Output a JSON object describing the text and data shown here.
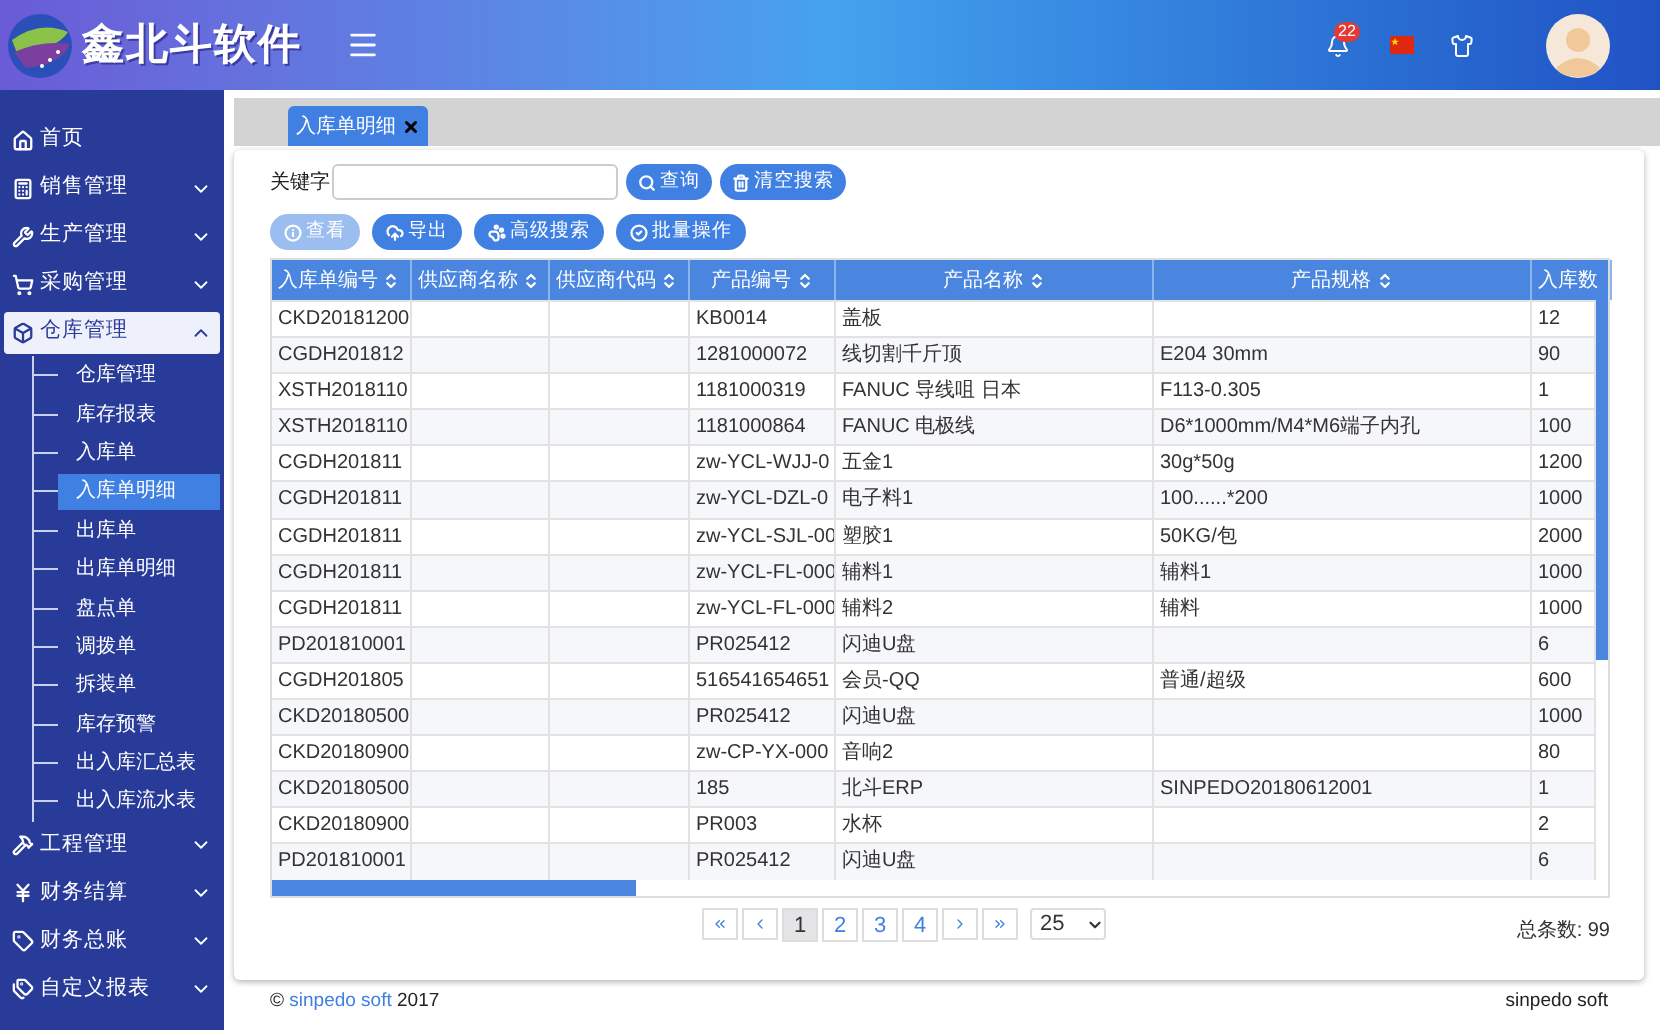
{
  "header": {
    "title": "鑫北斗软件",
    "notifications": "22"
  },
  "sidebar": {
    "items": [
      {
        "kind": "link",
        "label": "首页"
      },
      {
        "kind": "group",
        "label": "销售管理",
        "expanded": false
      },
      {
        "kind": "group",
        "label": "生产管理",
        "expanded": false
      },
      {
        "kind": "group",
        "label": "采购管理",
        "expanded": false
      },
      {
        "kind": "group",
        "label": "仓库管理",
        "expanded": true,
        "children": [
          {
            "label": "仓库管理",
            "selected": false
          },
          {
            "label": "库存报表",
            "selected": false
          },
          {
            "label": "入库单",
            "selected": false
          },
          {
            "label": "入库单明细",
            "selected": true
          },
          {
            "label": "出库单",
            "selected": false
          },
          {
            "label": "出库单明细",
            "selected": false
          },
          {
            "label": "盘点单",
            "selected": false
          },
          {
            "label": "调拨单",
            "selected": false
          },
          {
            "label": "拆装单",
            "selected": false
          },
          {
            "label": "库存预警",
            "selected": false
          },
          {
            "label": "出入库汇总表",
            "selected": false
          },
          {
            "label": "出入库流水表",
            "selected": false
          }
        ]
      },
      {
        "kind": "group",
        "label": "工程管理",
        "expanded": false
      },
      {
        "kind": "group",
        "label": "财务结算",
        "expanded": false
      },
      {
        "kind": "group",
        "label": "财务总账",
        "expanded": false
      },
      {
        "kind": "group",
        "label": "自定义报表",
        "expanded": false
      }
    ]
  },
  "tabs": [
    {
      "label": "入库单明细",
      "selected": true
    }
  ],
  "search": {
    "label": "关键字",
    "buttons": [
      "查询",
      "清空搜索"
    ]
  },
  "toolbar": [
    {
      "label": "查看",
      "disabled": true
    },
    {
      "label": "导出",
      "disabled": false
    },
    {
      "label": "高级搜索",
      "disabled": false
    },
    {
      "label": "批量操作",
      "disabled": false
    }
  ],
  "table": {
    "columns": [
      "入库单编号",
      "供应商名称",
      "供应商代码",
      "产品编号",
      "产品名称",
      "产品规格",
      "入库数"
    ],
    "rows": [
      [
        "CKD20181200",
        "",
        "",
        "KB0014",
        "盖板",
        "",
        "12"
      ],
      [
        "CGDH201812",
        "",
        "",
        "1281000072",
        "线切割千斤顶",
        "E204 30mm",
        "90"
      ],
      [
        "XSTH2018110",
        "",
        "",
        "1181000319",
        "FANUC 导线咀 日本",
        "F113-0.305",
        "1"
      ],
      [
        "XSTH2018110",
        "",
        "",
        "1181000864",
        "FANUC 电极线",
        "D6*1000mm/M4*M6端子内孔",
        "100"
      ],
      [
        "CGDH201811",
        "",
        "",
        "zw-YCL-WJJ-0",
        "五金1",
        "30g*50g",
        "1200"
      ],
      [
        "CGDH201811",
        "",
        "",
        "zw-YCL-DZL-0",
        "电子料1",
        "100......*200",
        "1000"
      ],
      [
        "CGDH201811",
        "",
        "",
        "zw-YCL-SJL-00",
        "塑胶1",
        "50KG/包",
        "2000"
      ],
      [
        "CGDH201811",
        "",
        "",
        "zw-YCL-FL-000",
        "辅料1",
        "辅料1",
        "1000"
      ],
      [
        "CGDH201811",
        "",
        "",
        "zw-YCL-FL-000",
        "辅料2",
        "辅料",
        "1000"
      ],
      [
        "PD201810001",
        "",
        "",
        "PR025412",
        "闪迪U盘",
        "",
        "6"
      ],
      [
        "CGDH201805",
        "",
        "",
        "516541654651",
        "会员-QQ",
        "普通/超级",
        "600"
      ],
      [
        "CKD20180500",
        "",
        "",
        "PR025412",
        "闪迪U盘",
        "",
        "1000"
      ],
      [
        "CKD20180900",
        "",
        "",
        "zw-CP-YX-000",
        "音响2",
        "",
        "80"
      ],
      [
        "CKD20180500",
        "",
        "",
        "185",
        "北斗ERP",
        "SINPEDO20180612001",
        "1"
      ],
      [
        "CKD20180900",
        "",
        "",
        "PR003",
        "水杯",
        "",
        "2"
      ],
      [
        "PD201810001",
        "",
        "",
        "PR025412",
        "闪迪U盘",
        "",
        "6"
      ]
    ]
  },
  "pagination": {
    "pages": [
      {
        "label": "1",
        "selected": true
      },
      {
        "label": "2",
        "selected": false
      },
      {
        "label": "3",
        "selected": false
      },
      {
        "label": "4",
        "selected": false
      }
    ],
    "page_size": "25",
    "total": "总条数: 99"
  },
  "footer": {
    "copyright": "©",
    "link": "sinpedo soft",
    "year": "2017",
    "right": "sinpedo soft"
  }
}
